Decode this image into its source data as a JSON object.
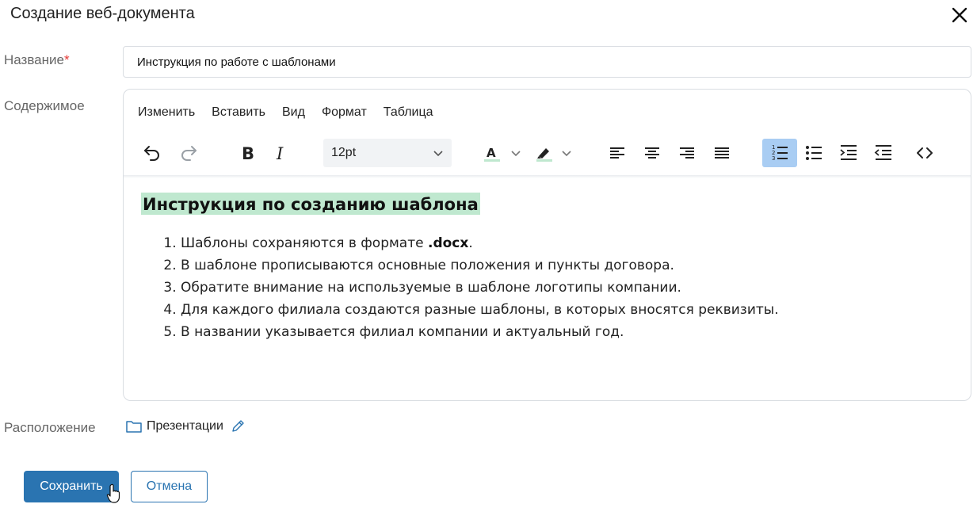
{
  "dialog": {
    "title": "Создание веб-документа"
  },
  "form": {
    "name_label": "Название",
    "required_mark": "*",
    "name_value": "Инструкция по работе с шаблонами",
    "content_label": "Содержимое",
    "location_label": "Расположение",
    "location_value": "Презентации"
  },
  "editor": {
    "menu": [
      "Изменить",
      "Вставить",
      "Вид",
      "Формат",
      "Таблица"
    ],
    "font_size": "12pt",
    "toolbar_icons": [
      "undo-icon",
      "redo-icon",
      "bold-icon",
      "italic-icon",
      "font-size-select",
      "text-color-icon",
      "highlight-color-icon",
      "align-left-icon",
      "align-center-icon",
      "align-right-icon",
      "align-justify-icon",
      "numbered-list-icon",
      "bulleted-list-icon",
      "indent-icon",
      "outdent-icon",
      "source-code-icon"
    ],
    "active_tool": "numbered-list-icon",
    "text_color_swatch": "#bfe8cf",
    "highlight_color_swatch": "#bfe8cf"
  },
  "document": {
    "heading": "Инструкция по созданию шаблона",
    "items": [
      {
        "text": "Шаблоны сохраняются в формате ",
        "bold": ".docx",
        "after": "."
      },
      {
        "text": "В шаблоне прописываются основные положения и пункты договора."
      },
      {
        "text": "Обратите внимание на используемые в шаблоне логотипы компании."
      },
      {
        "text": "Для каждого филиала создаются разные шаблоны, в которых вносятся реквизиты."
      },
      {
        "text": "В названии указывается филиал компании и актуальный год."
      }
    ]
  },
  "buttons": {
    "save": "Сохранить",
    "cancel": "Отмена"
  },
  "colors": {
    "primary": "#2a74b1",
    "heading_highlight": "#bfe8cf",
    "active_tool_bg": "#a9cdf3",
    "required": "#e53935"
  }
}
